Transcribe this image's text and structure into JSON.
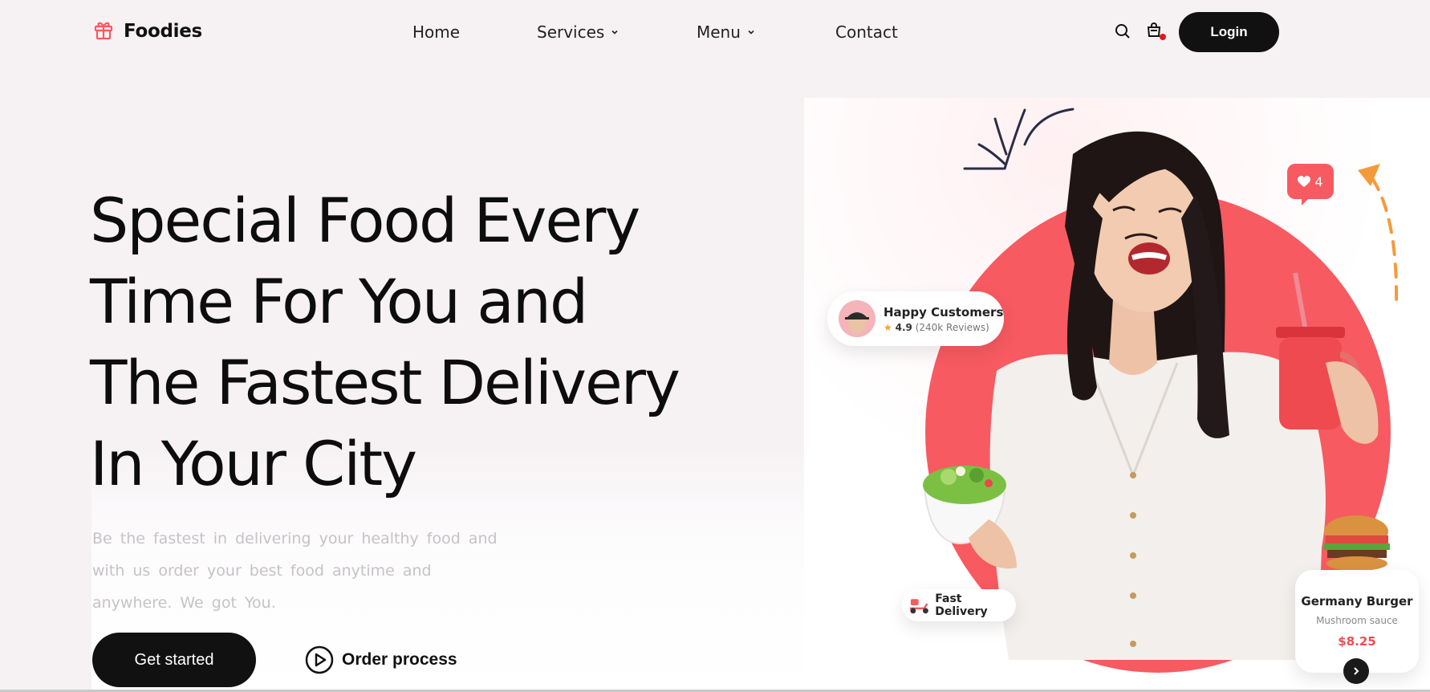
{
  "brand": {
    "name": "Foodies",
    "accent": "#f75a61",
    "dark": "#111111"
  },
  "nav": {
    "items": [
      {
        "label": "Home",
        "dropdown": false
      },
      {
        "label": "Services",
        "dropdown": true
      },
      {
        "label": "Menu",
        "dropdown": true
      },
      {
        "label": "Contact",
        "dropdown": false
      }
    ],
    "icons": [
      "search-icon",
      "cart-icon"
    ],
    "login_label": "Login"
  },
  "hero": {
    "headline_lines": [
      "Special Food Every",
      "Time For You and",
      "The Fastest Delivery",
      "In Your City"
    ],
    "subtext_lines": [
      "Be the fastest in delivering your healthy food and",
      "with us order your best food anytime and",
      "anywhere. We got You."
    ],
    "cta_label": "Get started",
    "secondary_label": "Order process"
  },
  "badges": {
    "likes": "4",
    "happy_customers": {
      "title": "Happy Customers",
      "rating": "4.9",
      "reviews": "(240k Reviews)"
    },
    "fast_delivery": "Fast Delivery",
    "product": {
      "name": "Germany Burger",
      "desc": "Mushroom sauce",
      "price": "$8.25"
    }
  }
}
